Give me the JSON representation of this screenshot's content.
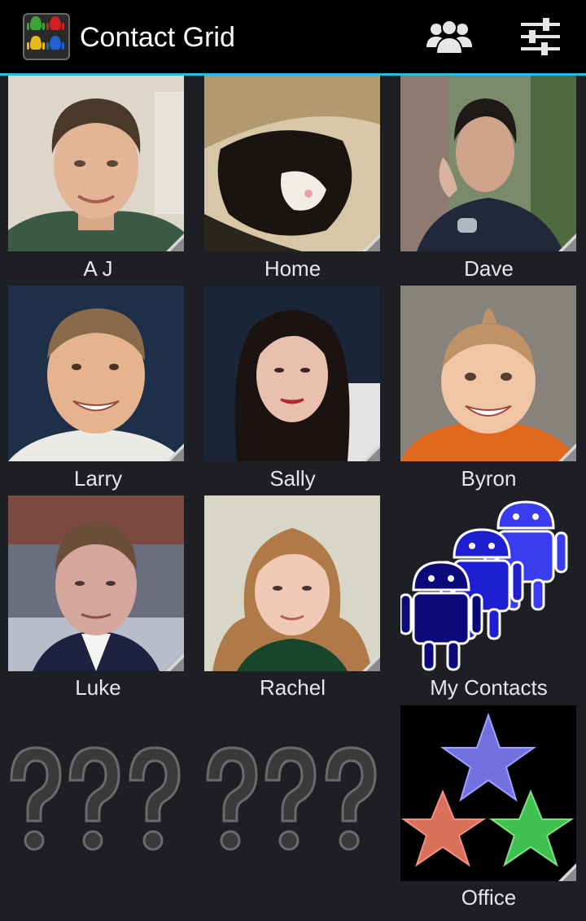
{
  "actionbar": {
    "title": "Contact Grid",
    "app_icon": "android-robots-app-icon",
    "people_button_icon": "people-group-icon",
    "settings_button_icon": "sliders-settings-icon",
    "accent_color": "#33b5e5"
  },
  "contacts": [
    {
      "name": "A J",
      "photo": "photo-man-smiling"
    },
    {
      "name": "Home",
      "photo": "photo-cat"
    },
    {
      "name": "Dave",
      "photo": "photo-man-gesture"
    },
    {
      "name": "Larry",
      "photo": "photo-man-smiling"
    },
    {
      "name": "Sally",
      "photo": "photo-woman"
    },
    {
      "name": "Byron",
      "photo": "photo-toddler"
    },
    {
      "name": "Luke",
      "photo": "photo-man"
    },
    {
      "name": "Rachel",
      "photo": "photo-girl"
    },
    {
      "name": "My Contacts",
      "photo": "android-robots-icon"
    },
    {
      "name": "",
      "photo": "unknown-question-marks-icon"
    },
    {
      "name": "",
      "photo": "unknown-question-marks-icon"
    },
    {
      "name": "Office",
      "photo": "stars-icon"
    }
  ]
}
